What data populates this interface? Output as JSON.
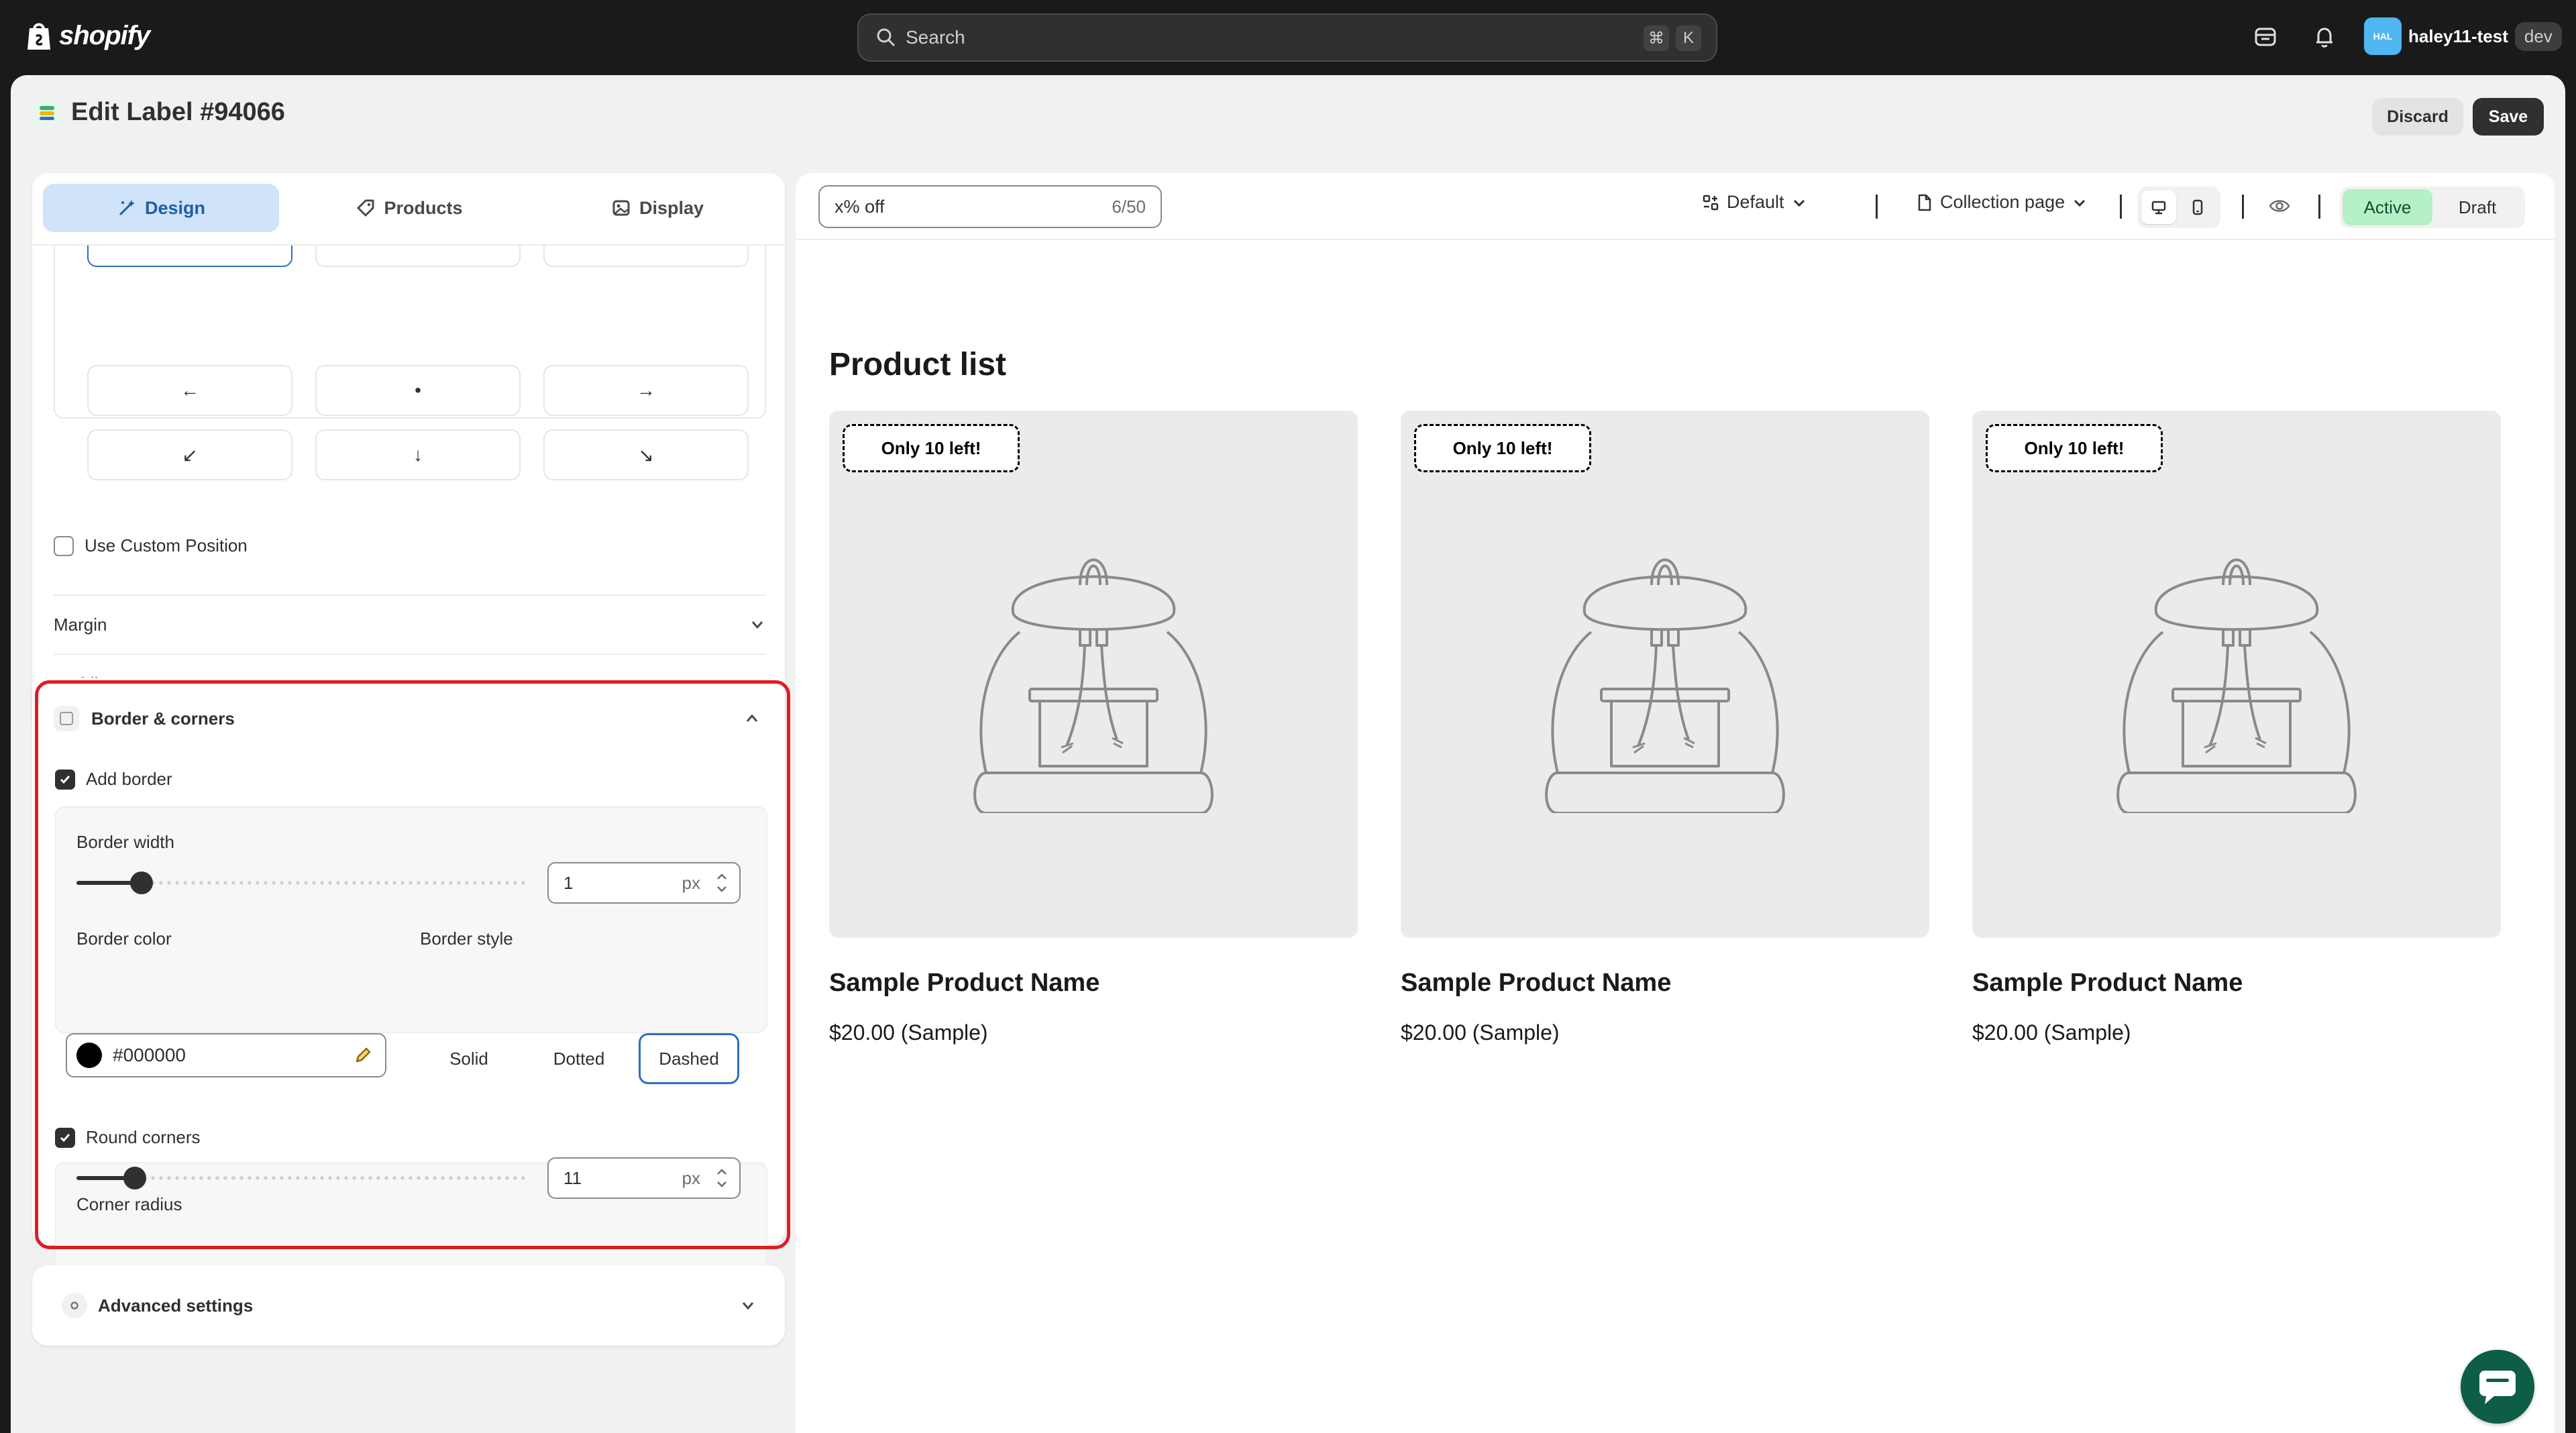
{
  "topbar": {
    "brand": "shopify",
    "search_placeholder": "Search",
    "search_shortcut": [
      "⌘",
      "K"
    ],
    "avatar_initials": "HAL",
    "user_name": "haley11-test",
    "env_badge": "dev"
  },
  "page": {
    "title": "Edit Label #94066",
    "discard_label": "Discard",
    "save_label": "Save"
  },
  "tabs": [
    {
      "label": "Design",
      "icon": "magic-icon",
      "active": true
    },
    {
      "label": "Products",
      "icon": "tag-icon",
      "active": false
    },
    {
      "label": "Display",
      "icon": "image-icon",
      "active": false
    }
  ],
  "position": {
    "buttons": [
      "←",
      "•",
      "→",
      "↙",
      "↓",
      "↘"
    ],
    "use_custom_position_label": "Use Custom Position",
    "use_custom_position_checked": false,
    "margin_label": "Margin",
    "padding_label": "Padding"
  },
  "border_section": {
    "title": "Border & corners",
    "add_border_label": "Add border",
    "add_border_checked": true,
    "border_width_label": "Border width",
    "border_width_value": "1",
    "border_width_unit": "px",
    "border_width_fraction": 0.05,
    "border_color_label": "Border color",
    "border_color_value": "#000000",
    "border_style_label": "Border style",
    "border_styles": [
      "Solid",
      "Dotted",
      "Dashed"
    ],
    "border_style_selected": "Dashed",
    "round_corners_label": "Round corners",
    "round_corners_checked": true,
    "corner_radius_label": "Corner radius",
    "corner_radius_value": "11",
    "corner_radius_unit": "px",
    "corner_radius_fraction": 0.04
  },
  "advanced": {
    "title": "Advanced settings"
  },
  "preview": {
    "label_text_value": "x% off",
    "label_text_counter": "6/50",
    "template_dropdown": "Default",
    "page_dropdown": "Collection page",
    "status_active": "Active",
    "status_draft": "Draft",
    "heading": "Product list",
    "products": [
      {
        "badge": "Only 10 left!",
        "name": "Sample Product Name",
        "price": "$20.00 (Sample)"
      },
      {
        "badge": "Only 10 left!",
        "name": "Sample Product Name",
        "price": "$20.00 (Sample)"
      },
      {
        "badge": "Only 10 left!",
        "name": "Sample Product Name",
        "price": "$20.00 (Sample)"
      }
    ]
  },
  "colors": {
    "accent_blue": "#2c6ecb",
    "active_green": "#b5f0c6",
    "highlight_red": "#e01b24",
    "chat_green": "#0d5d47"
  }
}
